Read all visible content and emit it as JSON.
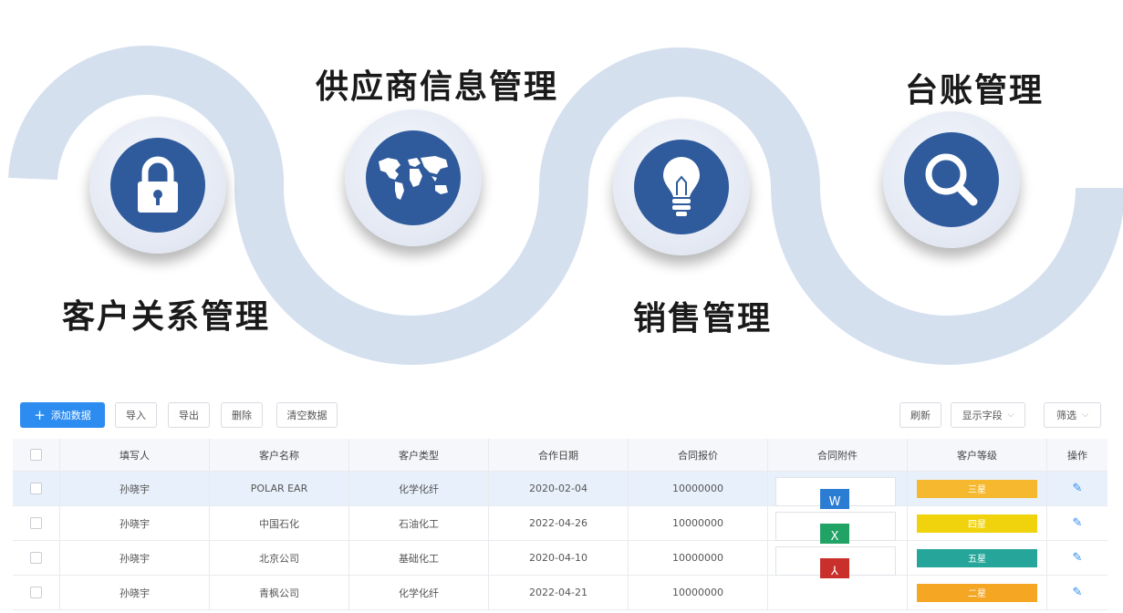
{
  "hero": {
    "items": [
      {
        "label": "客户关系管理",
        "icon": "lock-icon"
      },
      {
        "label": "供应商信息管理",
        "icon": "world-map-icon"
      },
      {
        "label": "销售管理",
        "icon": "lightbulb-icon"
      },
      {
        "label": "台账管理",
        "icon": "search-icon"
      }
    ],
    "colors": {
      "wave": "#d5e0ef",
      "circle": "#2f5b9c"
    }
  },
  "toolbar": {
    "add_label": "添加数据",
    "import_label": "导入",
    "export_label": "导出",
    "delete_label": "删除",
    "clear_label": "清空数据",
    "refresh_label": "刷新",
    "fields_label": "显示字段",
    "filter_label": "筛选"
  },
  "table": {
    "columns": [
      "填写人",
      "客户名称",
      "客户类型",
      "合作日期",
      "合同报价",
      "合同附件",
      "客户等级",
      "操作"
    ],
    "rows": [
      {
        "filler": "孙晓宇",
        "name": "POLAR EAR",
        "type": "化学化纤",
        "date": "2020-02-04",
        "price": "10000000",
        "file": "W",
        "file_color": "#2b7cd3",
        "level": "三星",
        "level_color": "#f5b82e"
      },
      {
        "filler": "孙晓宇",
        "name": "中国石化",
        "type": "石油化工",
        "date": "2022-04-26",
        "price": "10000000",
        "file": "X",
        "file_color": "#21a366",
        "level": "四星",
        "level_color": "#f0d30c"
      },
      {
        "filler": "孙晓宇",
        "name": "北京公司",
        "type": "基础化工",
        "date": "2020-04-10",
        "price": "10000000",
        "file": "⅄",
        "file_color": "#c9302c",
        "level": "五星",
        "level_color": "#26a69a"
      },
      {
        "filler": "孙晓宇",
        "name": "青枫公司",
        "type": "化学化纤",
        "date": "2022-04-21",
        "price": "10000000",
        "file": "",
        "file_color": "",
        "level": "二星",
        "level_color": "#f5a623"
      }
    ],
    "accent": "#2d8cf0"
  }
}
